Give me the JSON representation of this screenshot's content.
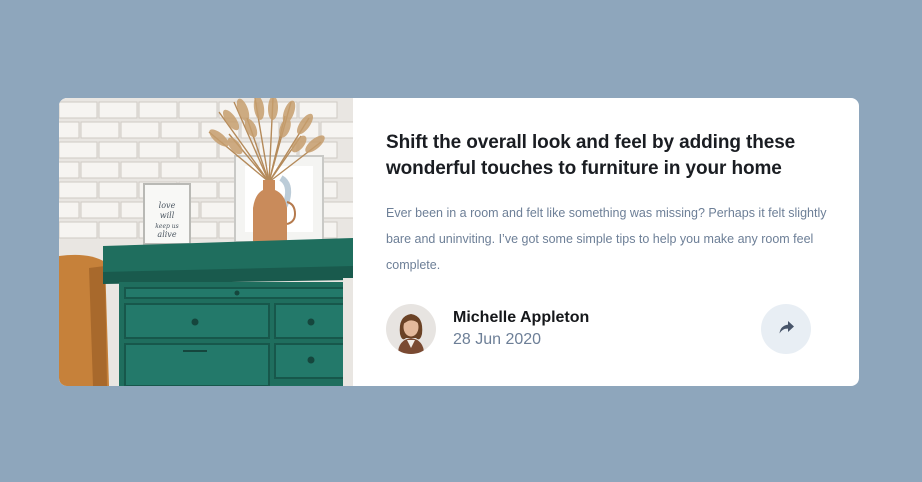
{
  "article": {
    "title": "Shift the overall look and feel by adding these wonderful touches to furniture in your home",
    "description": "Ever been in a room and felt like something was missing? Perhaps it felt slightly bare and uninviting. I’ve got some simple tips to help you make any room feel complete."
  },
  "author": {
    "name": "Michelle Appleton",
    "date": "28 Jun 2020"
  },
  "image": {
    "frame_text": "love will keep us alive"
  },
  "icons": {
    "share": "share-arrow-icon"
  },
  "colors": {
    "background": "#8ea6bc",
    "card": "#ffffff",
    "title": "#1a1d22",
    "body_text": "#6d7f97",
    "share_button_bg": "#e8eef4",
    "dresser": "#1f6e5e"
  }
}
